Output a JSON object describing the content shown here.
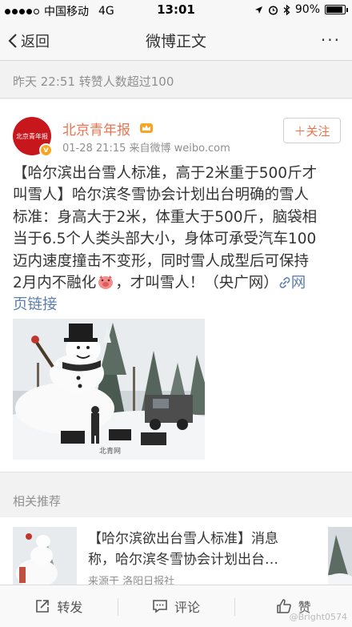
{
  "status_bar": {
    "carrier": "中国移动",
    "network": "4G",
    "time": "13:01",
    "battery": "90%",
    "battery_level": 0.9
  },
  "nav": {
    "back_label": "返回",
    "title": "微博正文",
    "more": "···"
  },
  "meta": {
    "text": "昨天 22:51 转赞人数超过100"
  },
  "post": {
    "avatar_text": "北京青年报",
    "author": "北京青年报",
    "time_source": "01-28 21:15  来自微博 weibo.com",
    "follow_label": "＋关注",
    "text_lines": [
      "【哈尔滨出台雪人标准，高于2米重于500斤才",
      "叫雪人】哈尔滨冬雪协会计划出台明确的雪人",
      "标准：身高大于2米，体重大于500斤，脑袋相",
      "当于6.5个人类头部大小，身体可承受汽车100",
      "迈内速度撞击不变形，同时雪人成型后可保持"
    ],
    "line6_before": "2月内不融化",
    "line6_after": "，才叫雪人！（央广网）",
    "link_part1": "网",
    "link_part2": "页链接",
    "image_watermark": "北青网"
  },
  "related": {
    "header": "相关推荐",
    "title_lines": [
      "【哈尔滨欲出台雪人标准】消息",
      "称，哈尔滨冬雪协会计划出台…"
    ],
    "source": "来源于 洛阳日报社"
  },
  "bottom_bar": {
    "repost": "转发",
    "comment": "评论",
    "like": "赞"
  },
  "watermark": "@Bright0574"
}
